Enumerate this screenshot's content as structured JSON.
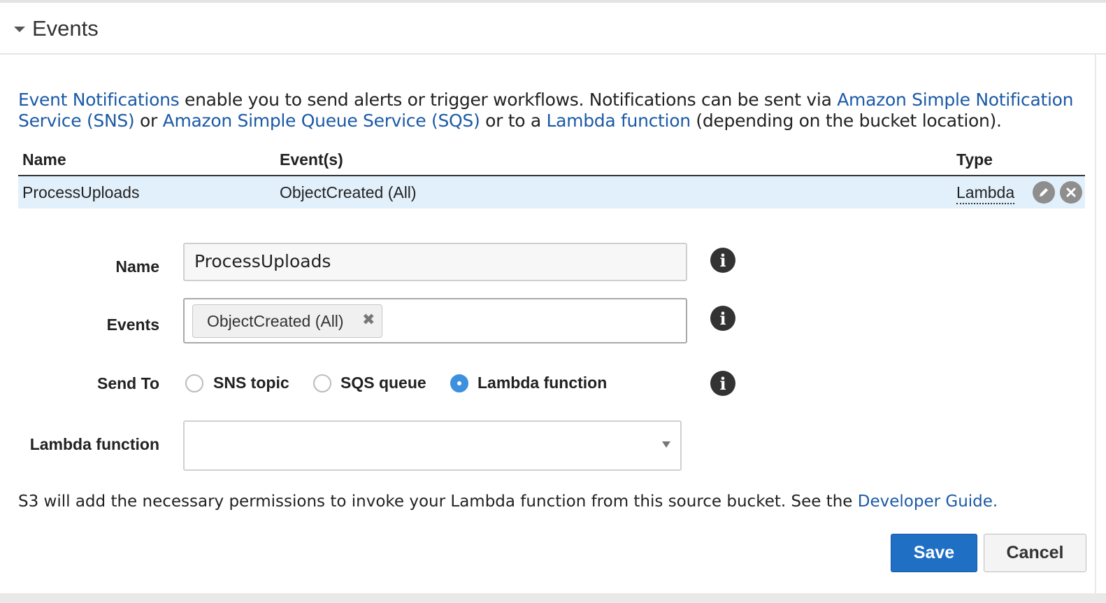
{
  "section": {
    "title": "Events"
  },
  "intro": {
    "link_event_notifications": "Event Notifications",
    "text1": " enable you to send alerts or trigger workflows. Notifications can be sent via ",
    "link_sns": "Amazon Simple Notification Service (SNS)",
    "text2": " or ",
    "link_sqs": "Amazon Simple Queue Service (SQS)",
    "text3": " or to a ",
    "link_lambda": "Lambda function",
    "text4": " (depending on the bucket location)."
  },
  "table": {
    "headers": {
      "name": "Name",
      "events": "Event(s)",
      "type": "Type"
    },
    "rows": [
      {
        "name": "ProcessUploads",
        "events": "ObjectCreated (All)",
        "type": "Lambda"
      }
    ]
  },
  "form": {
    "name_label": "Name",
    "name_value": "ProcessUploads",
    "events_label": "Events",
    "events_tags": [
      "ObjectCreated (All)"
    ],
    "send_to_label": "Send To",
    "send_to_options": [
      "SNS topic",
      "SQS queue",
      "Lambda function"
    ],
    "send_to_selected": "Lambda function",
    "lambda_label": "Lambda function",
    "lambda_value": ""
  },
  "note": {
    "text": "S3 will add the necessary permissions to invoke your Lambda function from this source bucket. See the ",
    "link": "Developer Guide."
  },
  "buttons": {
    "save": "Save",
    "cancel": "Cancel"
  },
  "colors": {
    "link": "#1b5aa6",
    "primary": "#1f6fc5",
    "row_highlight": "#e2f0fb",
    "radio_selected": "#3d8fe0"
  }
}
